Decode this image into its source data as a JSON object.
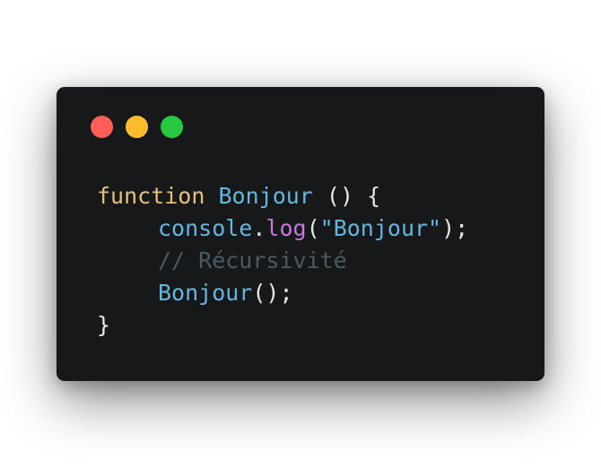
{
  "window": {
    "controls": {
      "close_color": "#ff5f57",
      "minimize_color": "#febc2e",
      "maximize_color": "#28c840"
    }
  },
  "code": {
    "line1": {
      "keyword": "function",
      "name": "Bonjour",
      "parens": "()",
      "brace_open": "{"
    },
    "line2": {
      "object": "console",
      "dot": ".",
      "method": "log",
      "paren_open": "(",
      "string": "\"Bonjour\"",
      "paren_close_semi": ");"
    },
    "line3": {
      "comment": "// Récursivité"
    },
    "line4": {
      "call": "Bonjour",
      "call_parens": "();"
    },
    "line5": {
      "brace_close": "}"
    }
  }
}
